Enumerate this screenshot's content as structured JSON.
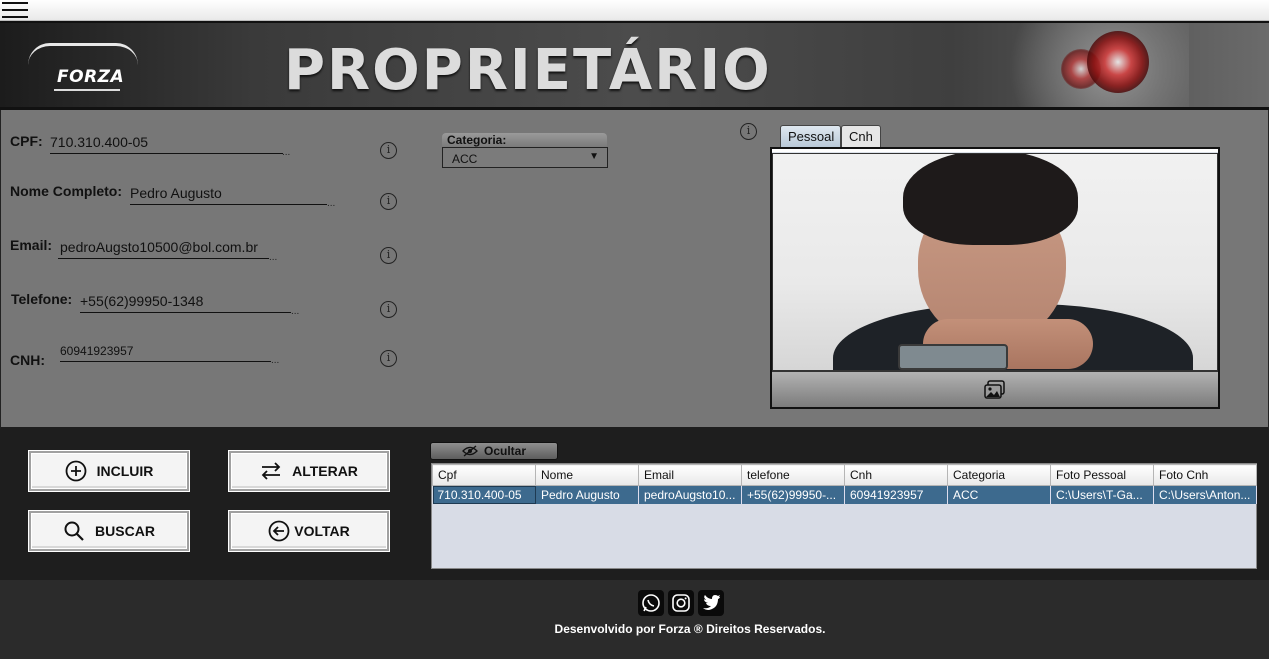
{
  "banner": {
    "title": "PROPRIETÁRIO",
    "logo_text": "FORZA"
  },
  "form": {
    "cpf_label": "CPF:",
    "cpf_value": "710.310.400-05",
    "nome_label": "Nome Completo:",
    "nome_value": "Pedro Augusto",
    "email_label": "Email:",
    "email_value": "pedroAugsto10500@bol.com.br",
    "telefone_label": "Telefone:",
    "telefone_value": "+55(62)99950-1348",
    "cnh_label": "CNH:",
    "cnh_value": "60941923957",
    "dots": "...",
    "categoria_label": "Categoria:",
    "categoria_value": "ACC"
  },
  "photo_tabs": [
    "Pessoal",
    "Cnh"
  ],
  "buttons": {
    "incluir": "INCLUIR",
    "alterar": "ALTERAR",
    "buscar": "BUSCAR",
    "voltar": "VOLTAR",
    "ocultar": "Ocultar"
  },
  "table": {
    "headers": [
      "Cpf",
      "Nome",
      "Email",
      "telefone",
      "Cnh",
      "Categoria",
      "Foto Pessoal",
      "Foto Cnh"
    ],
    "rows": [
      [
        "710.310.400-05",
        "Pedro Augusto",
        "pedroAugsto10...",
        "+55(62)99950-...",
        "60941923957",
        "ACC",
        "C:\\Users\\T-Ga...",
        "C:\\Users\\Anton..."
      ]
    ]
  },
  "footer": {
    "text": "Desenvolvido por Forza ® Direitos Reservados."
  },
  "icons": [
    "menu-icon",
    "info-icon",
    "add-circle-icon",
    "swap-arrows-icon",
    "search-icon",
    "back-arrow-circle-icon",
    "eye-slash-icon",
    "image-icon",
    "whatsapp-icon",
    "instagram-icon",
    "twitter-icon"
  ],
  "colors": {
    "form_bg": "#777777",
    "bottom_bg": "#1e1e1e",
    "selected_row": "#3d6a8e",
    "footer_bg": "#2b2b2b"
  }
}
